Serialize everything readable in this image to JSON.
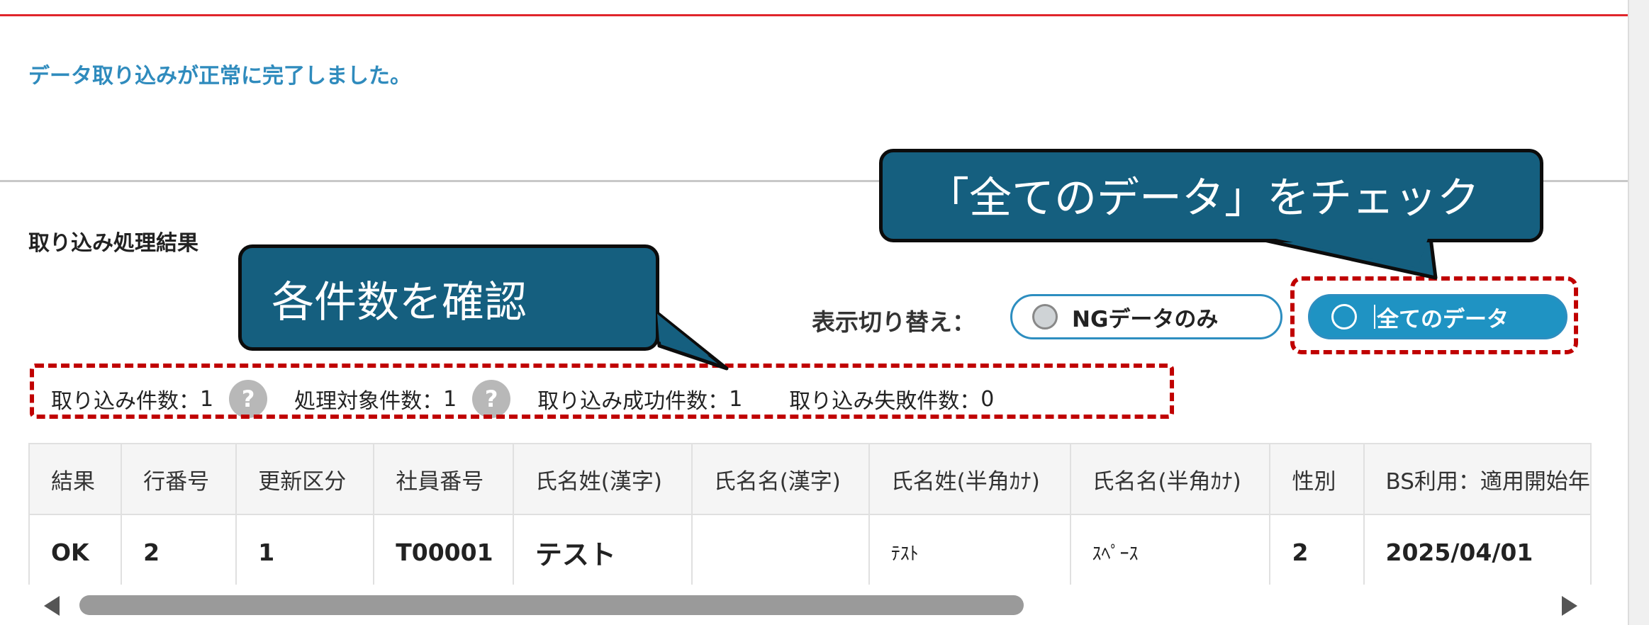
{
  "message": "データ取り込みが正常に完了しました。",
  "section_title": "取り込み処理結果",
  "view_toggle": {
    "label": "表示切り替え：",
    "options": [
      "NGデータのみ",
      "全てのデータ"
    ],
    "selected": "全てのデータ"
  },
  "counts": {
    "import_label": "取り込み件数：",
    "import_value": "1",
    "target_label": "処理対象件数：",
    "target_value": "1",
    "success_label": "取り込み成功件数：",
    "success_value": "1",
    "failure_label": "取り込み失敗件数：",
    "failure_value": "0",
    "help_glyph": "?"
  },
  "callouts": {
    "counts": "各件数を確認",
    "check_all": "「全てのデータ」をチェック"
  },
  "table": {
    "headers": [
      "結果",
      "行番号",
      "更新区分",
      "社員番号",
      "氏名姓(漢字)",
      "氏名名(漢字)",
      "氏名姓(半角ｶﾅ)",
      "氏名名(半角ｶﾅ)",
      "性別",
      "BS利用：適用開始年"
    ],
    "rows": [
      [
        "OK",
        "2",
        "1",
        "T00001",
        "テスト",
        "",
        "ﾃｽﾄ",
        "ｽﾍﾟｰｽ",
        "2",
        "2025/04/01"
      ]
    ]
  },
  "colors": {
    "accent": "#1f93c3",
    "callout": "#155f7f",
    "highlight_dash": "#c00000",
    "message": "#2f8bbd",
    "top_line": "#e0252b"
  },
  "horizontal_scroll_fraction": 0.6
}
